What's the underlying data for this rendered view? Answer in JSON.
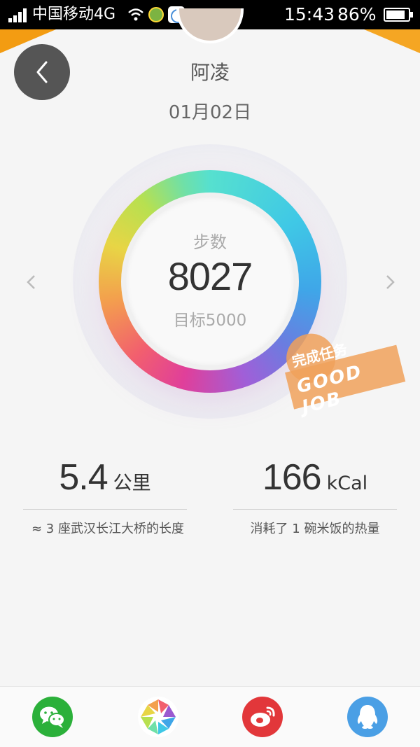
{
  "status_bar": {
    "carrier": "中国移动4G",
    "time": "15:43",
    "battery": "86%",
    "battery_level": 0.86
  },
  "header": {
    "name": "阿凌",
    "date": "01月02日"
  },
  "ring": {
    "label": "步数",
    "steps": "8027",
    "goal": "目标5000"
  },
  "stamp": {
    "cn": "完成任务",
    "en": "GOOD JOB"
  },
  "stats": {
    "distance": {
      "value": "5.4",
      "unit": "公里",
      "desc": "≈ 3 座武汉长江大桥的长度"
    },
    "calories": {
      "value": "166",
      "unit": "kCal",
      "desc": "消耗了 1 碗米饭的热量"
    }
  },
  "share": [
    "wechat-icon",
    "moments-icon",
    "weibo-icon",
    "qq-icon"
  ]
}
